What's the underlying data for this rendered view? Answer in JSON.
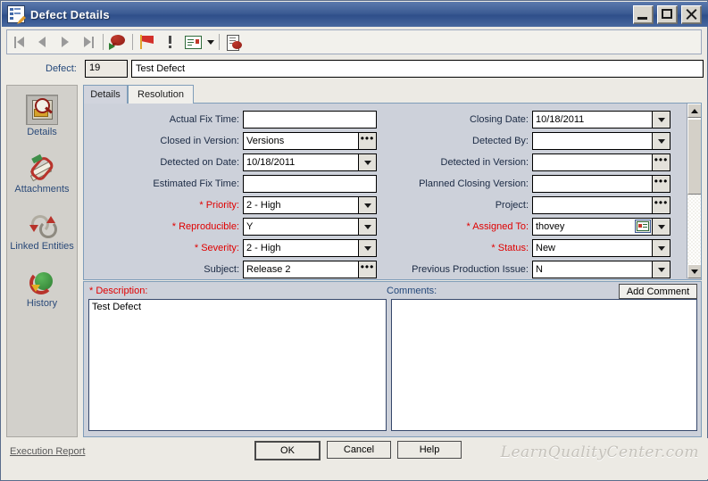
{
  "window": {
    "title": "Defect Details",
    "icon": "defect-details-icon",
    "buttons": {
      "minimize": "minimize",
      "maximize": "maximize",
      "close": "close"
    }
  },
  "toolbar": {
    "items": [
      {
        "name": "first-record-button",
        "icon": "first-record-icon"
      },
      {
        "name": "previous-record-button",
        "icon": "previous-record-icon"
      },
      {
        "name": "next-record-button",
        "icon": "next-record-icon"
      },
      {
        "name": "last-record-button",
        "icon": "last-record-icon"
      },
      {
        "name": "new-defect-button",
        "icon": "defect-add-icon"
      },
      {
        "name": "flag-button",
        "icon": "red-flag-icon"
      },
      {
        "name": "alert-button",
        "icon": "exclamation-icon"
      },
      {
        "name": "send-email-button",
        "icon": "mail-icon"
      },
      {
        "name": "send-email-dropdown",
        "icon": "chevron-down-icon"
      },
      {
        "name": "defect-report-button",
        "icon": "document-comment-icon"
      }
    ]
  },
  "defect": {
    "label": "Defect:",
    "id": "19",
    "summary": "Test Defect"
  },
  "tabs": [
    {
      "label": "Details",
      "active": true
    },
    {
      "label": "Resolution",
      "active": false
    }
  ],
  "sidebar": {
    "items": [
      {
        "label": "Details",
        "icon": "details-magnifier-icon",
        "selected": true
      },
      {
        "label": "Attachments",
        "icon": "paperclip-icon",
        "selected": false
      },
      {
        "label": "Linked Entities",
        "icon": "linked-entities-icon",
        "selected": false
      },
      {
        "label": "History",
        "icon": "history-globe-icon",
        "selected": false
      }
    ]
  },
  "form": {
    "left": [
      {
        "label": "Actual Fix Time:",
        "value": "",
        "required": false,
        "control": "text"
      },
      {
        "label": "Closed in Version:",
        "value": "Versions",
        "required": false,
        "control": "browse"
      },
      {
        "label": "Detected on Date:",
        "value": "10/18/2011",
        "required": false,
        "control": "dropdown"
      },
      {
        "label": "Estimated Fix Time:",
        "value": "",
        "required": false,
        "control": "text"
      },
      {
        "label": "* Priority:",
        "value": "2 - High",
        "required": true,
        "control": "dropdown"
      },
      {
        "label": "* Reproducible:",
        "value": "Y",
        "required": true,
        "control": "dropdown"
      },
      {
        "label": "* Severity:",
        "value": "2 - High",
        "required": true,
        "control": "dropdown"
      },
      {
        "label": "Subject:",
        "value": "Release 2",
        "required": false,
        "control": "browse"
      }
    ],
    "right": [
      {
        "label": "Closing Date:",
        "value": "10/18/2011",
        "required": false,
        "control": "dropdown"
      },
      {
        "label": "Detected By:",
        "value": "",
        "required": false,
        "control": "dropdown"
      },
      {
        "label": "Detected in Version:",
        "value": "",
        "required": false,
        "control": "browse"
      },
      {
        "label": "Planned Closing Version:",
        "value": "",
        "required": false,
        "control": "browse"
      },
      {
        "label": "Project:",
        "value": "",
        "required": false,
        "control": "browse"
      },
      {
        "label": "* Assigned To:",
        "value": "thovey",
        "required": true,
        "control": "user-dropdown"
      },
      {
        "label": "* Status:",
        "value": "New",
        "required": true,
        "control": "dropdown"
      },
      {
        "label": "Previous Production Issue:",
        "value": "N",
        "required": false,
        "control": "dropdown"
      }
    ]
  },
  "description": {
    "label": "* Description:",
    "value": "Test Defect"
  },
  "comments": {
    "label": "Comments:",
    "value": "",
    "add_button": "Add Comment"
  },
  "footer": {
    "execution_report": "Execution Report",
    "ok": "OK",
    "cancel": "Cancel",
    "help": "Help",
    "watermark": "LearnQualityCenter.com"
  },
  "colors": {
    "title_bar": "#3c5c94",
    "required_label": "#e00000",
    "label": "#1b2a44",
    "panel": "#cdd1da",
    "sidebar": "#d2d0cb"
  }
}
